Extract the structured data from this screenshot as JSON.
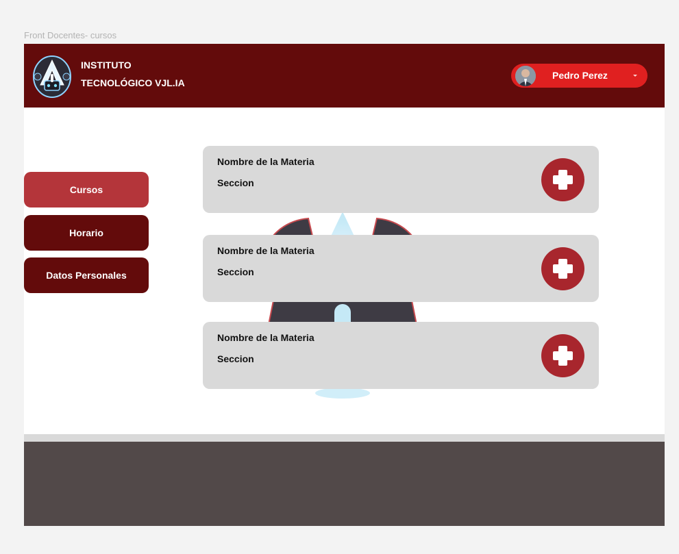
{
  "frame_label": "Front Docentes- cursos",
  "header": {
    "brand_line1": "INSTITUTO",
    "brand_line2": "TECNOLÓGICO VJL.IA",
    "user_name": "Pedro Perez",
    "logo_icon": "robot-logo-icon",
    "caret_icon": "caret-down-icon"
  },
  "sidebar": {
    "items": [
      {
        "label": "Cursos",
        "active": true
      },
      {
        "label": "Horario",
        "active": false
      },
      {
        "label": "Datos Personales",
        "active": false
      }
    ]
  },
  "courses": [
    {
      "subject": "Nombre de la Materia",
      "section": "Seccion"
    },
    {
      "subject": "Nombre de la Materia",
      "section": "Seccion"
    },
    {
      "subject": "Nombre de la Materia",
      "section": "Seccion"
    }
  ],
  "colors": {
    "header_bg": "#630b0b",
    "nav_active": "#b4353a",
    "nav_inactive": "#630b0b",
    "user_pill": "#e02020",
    "card_bg": "#d9d9d9",
    "add_button": "#a8262d",
    "footer_bg": "#524949"
  }
}
